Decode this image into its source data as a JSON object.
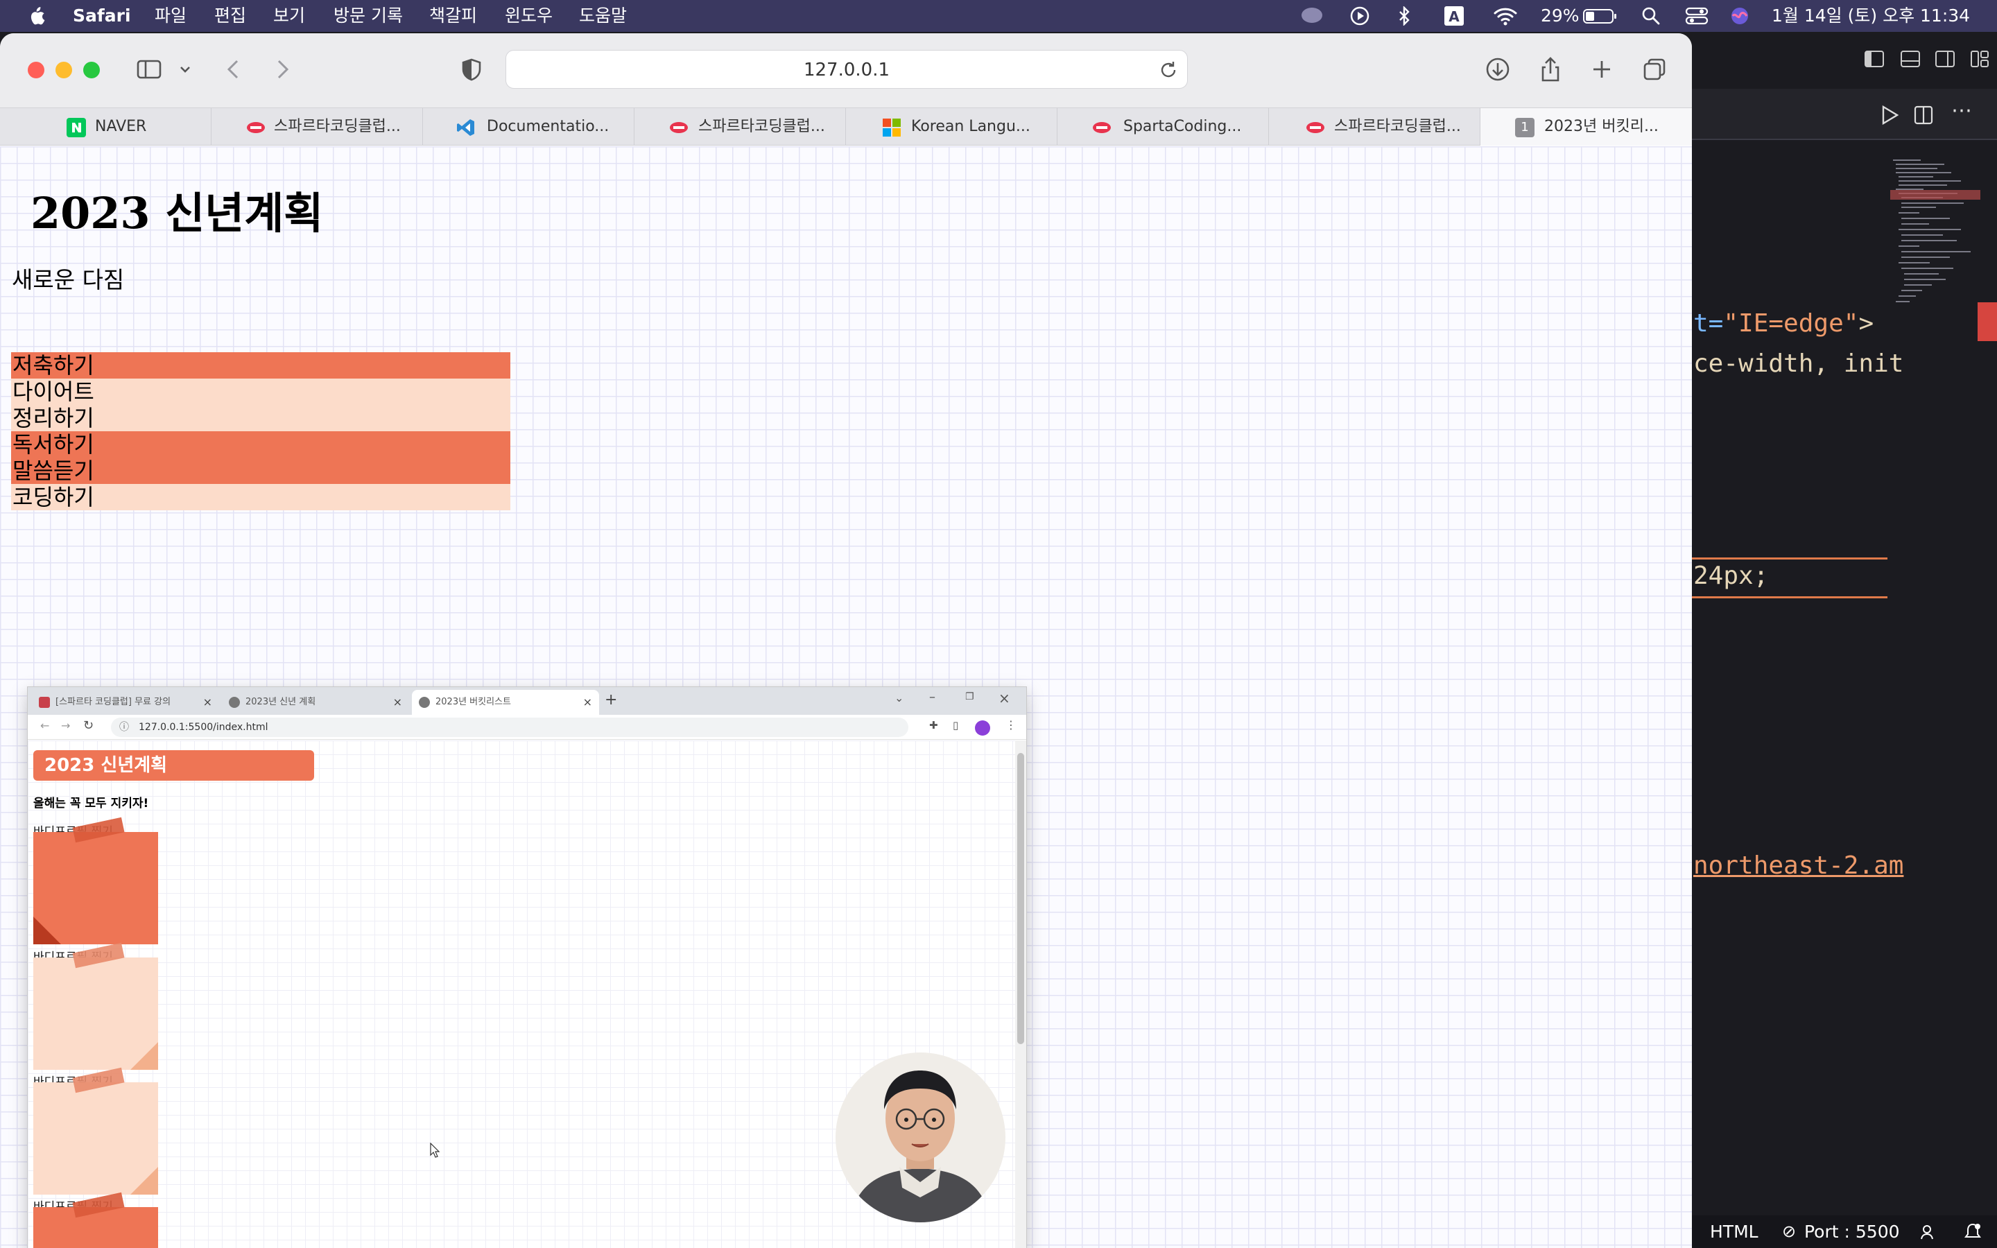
{
  "menubar": {
    "app_name": "Safari",
    "items": [
      "파일",
      "편집",
      "보기",
      "방문 기록",
      "책갈피",
      "윈도우",
      "도움말"
    ],
    "battery_percent": "29%",
    "datetime": "1월 14일 (토) 오후 11:34"
  },
  "safari": {
    "url": "127.0.0.1",
    "tabs": [
      {
        "label": "NAVER",
        "icon": "naver-favicon"
      },
      {
        "label": "스파르타코딩클럽...",
        "icon": "sparta-favicon"
      },
      {
        "label": "Documentatio...",
        "icon": "vscode-favicon"
      },
      {
        "label": "스파르타코딩클럽...",
        "icon": "sparta-favicon"
      },
      {
        "label": "Korean Langu...",
        "icon": "microsoft-favicon"
      },
      {
        "label": "SpartaCoding...",
        "icon": "sparta-favicon"
      },
      {
        "label": "스파르타코딩클럽...",
        "icon": "sparta-favicon"
      },
      {
        "label": "2023년 버킷리...",
        "icon": "number-1-favicon",
        "badge": "1"
      }
    ]
  },
  "page": {
    "title": "2023 신년계획",
    "subtitle": "새로운 다짐",
    "goals": [
      {
        "text": "저축하기",
        "style": "dark"
      },
      {
        "text": "다이어트",
        "style": "light"
      },
      {
        "text": "정리하기",
        "style": "light"
      },
      {
        "text": "독서하기",
        "style": "dark"
      },
      {
        "text": "말씀듣기",
        "style": "dark"
      },
      {
        "text": "코딩하기",
        "style": "light"
      }
    ],
    "colors": {
      "dark": "#ee7555",
      "light": "#fcdcca"
    }
  },
  "chrome": {
    "tabs": [
      {
        "label": "[스파르타 코딩클럽] 무료 강의"
      },
      {
        "label": "2023년 신년 계획"
      },
      {
        "label": "2023년 버킷리스트"
      }
    ],
    "address": "127.0.0.1:5500/index.html",
    "header": "2023 신년계획",
    "subline": "올해는 꼭 모두 지키자!",
    "note_label": "바디프로필 찍기",
    "notes": [
      "dark",
      "light",
      "light",
      "dark"
    ]
  },
  "editor": {
    "lines": [
      {
        "text_a": "t=",
        "text_s": "\"IE=edge\"",
        "text_b": ">"
      },
      {
        "text_a": "ce-width, init"
      },
      {
        "text_a": "24px;"
      },
      {
        "text_a": "northeast-2.am"
      }
    ],
    "status": {
      "language": "HTML",
      "port": "Port : 5500"
    }
  }
}
